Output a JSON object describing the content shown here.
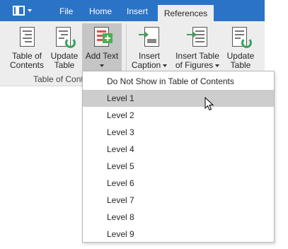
{
  "tabs": {
    "file": "File",
    "home": "Home",
    "insert": "Insert",
    "references": "References"
  },
  "ribbon": {
    "table_of_contents": {
      "line1": "Table of",
      "line2": "Contents"
    },
    "update_table_1": {
      "line1": "Update",
      "line2": "Table"
    },
    "add_text": {
      "line1": "Add Text"
    },
    "insert_caption": {
      "line1": "Insert",
      "line2": "Caption"
    },
    "insert_table_of_figures": {
      "line1": "Insert Table",
      "line2": "of Figures"
    },
    "update_table_2": {
      "line1": "Update",
      "line2": "Table"
    },
    "group_label": "Table of Conte"
  },
  "menu": {
    "items": [
      "Do Not Show in Table of Contents",
      "Level 1",
      "Level 2",
      "Level 3",
      "Level 4",
      "Level 5",
      "Level 6",
      "Level 7",
      "Level 8",
      "Level 9"
    ],
    "hovered_index": 1
  },
  "colors": {
    "tabbar": "#2b73c6",
    "ribbon": "#ededed",
    "hover": "#cdcdcd"
  }
}
